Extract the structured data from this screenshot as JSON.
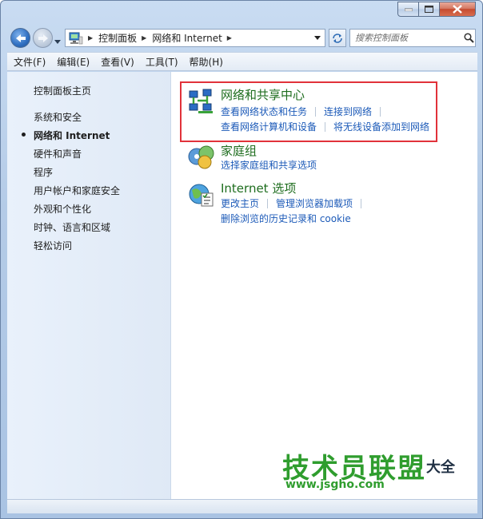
{
  "window": {
    "caption_buttons": [
      "minimize",
      "maximize",
      "close"
    ]
  },
  "address_bar": {
    "crumbs": [
      "控制面板",
      "网络和 Internet"
    ],
    "search_placeholder": "搜索控制面板"
  },
  "menu": {
    "items": [
      "文件(F)",
      "编辑(E)",
      "查看(V)",
      "工具(T)",
      "帮助(H)"
    ]
  },
  "sidebar": {
    "items": [
      {
        "label": "控制面板主页",
        "active": false
      },
      {
        "label": "系统和安全",
        "active": false
      },
      {
        "label": "网络和 Internet",
        "active": true
      },
      {
        "label": "硬件和声音",
        "active": false
      },
      {
        "label": "程序",
        "active": false
      },
      {
        "label": "用户帐户和家庭安全",
        "active": false
      },
      {
        "label": "外观和个性化",
        "active": false
      },
      {
        "label": "时钟、语言和区域",
        "active": false
      },
      {
        "label": "轻松访问",
        "active": false
      }
    ]
  },
  "sections": [
    {
      "title": "网络和共享中心",
      "icon": "network-sharing-center-icon",
      "highlighted": true,
      "rows": [
        [
          "查看网络状态和任务",
          "连接到网络"
        ],
        [
          "查看网络计算机和设备",
          "将无线设备添加到网络"
        ]
      ]
    },
    {
      "title": "家庭组",
      "icon": "homegroup-icon",
      "highlighted": false,
      "rows": [
        [
          "选择家庭组和共享选项"
        ]
      ]
    },
    {
      "title": "Internet 选项",
      "icon": "internet-options-icon",
      "highlighted": false,
      "rows": [
        [
          "更改主页",
          "管理浏览器加载项"
        ],
        [
          "删除浏览的历史记录和 cookie"
        ]
      ]
    }
  ],
  "watermark": {
    "title": "技术员联盟",
    "url": "www.jsgho.com",
    "side_text": "大全"
  },
  "colors": {
    "section_title": "#1e6d1e",
    "task_link": "#1c5ab8",
    "highlight_box": "#e1323a",
    "sidebar_bg": "#e4edf8",
    "watermark": "#2f9d2e"
  }
}
